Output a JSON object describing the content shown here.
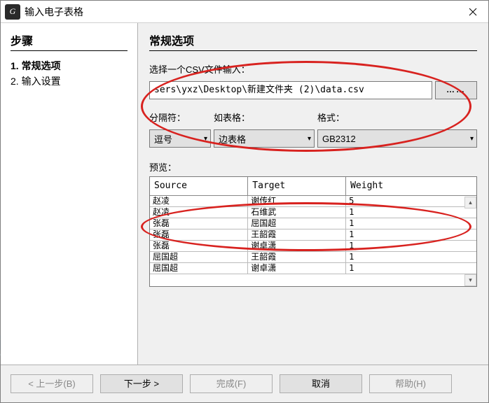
{
  "window": {
    "title": "输入电子表格",
    "icon_text": "G"
  },
  "left": {
    "heading": "步骤",
    "steps": [
      {
        "num": "1.",
        "label": "常规选项",
        "current": true
      },
      {
        "num": "2.",
        "label": "输入设置",
        "current": false
      }
    ]
  },
  "right": {
    "heading": "常规选项",
    "file_label": "选择一个CSV文件输入：",
    "file_path": "sers\\yxz\\Desktop\\新建文件夹 (2)\\data.csv",
    "browse_label": "……",
    "sep_label": "分隔符：",
    "table_label": "如表格：",
    "format_label": "格式：",
    "sep_value": "逗号",
    "table_value": "边表格",
    "format_value": "GB2312",
    "preview_label": "预览："
  },
  "preview": {
    "columns": [
      "Source",
      "Target",
      "Weight"
    ],
    "rows": [
      [
        "赵凌",
        "谢传红",
        "5"
      ],
      [
        "赵凌",
        "石维武",
        "1"
      ],
      [
        "张磊",
        "屈国超",
        "1"
      ],
      [
        "张磊",
        "王韶霞",
        "1"
      ],
      [
        "张磊",
        "谢卓潇",
        "1"
      ],
      [
        "屈国超",
        "王韶霞",
        "1"
      ],
      [
        "屈国超",
        "谢卓潇",
        "1"
      ]
    ]
  },
  "buttons": {
    "prev": "< 上一步(B)",
    "next": "下一步 >",
    "finish": "完成(F)",
    "cancel": "取消",
    "help": "帮助(H)"
  }
}
